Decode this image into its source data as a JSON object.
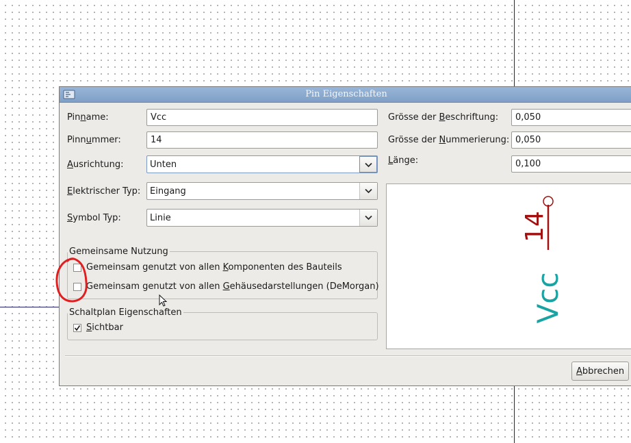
{
  "dialog": {
    "title": "Pin Eigenschaften",
    "pin_name": {
      "label_pre": "Pin",
      "label_acc": "n",
      "label_post": "ame:",
      "value": "Vcc"
    },
    "pin_number": {
      "label_pre": "Pinn",
      "label_acc": "u",
      "label_post": "mmer:",
      "value": "14"
    },
    "orientation": {
      "label_acc": "A",
      "label_post": "usrichtung:",
      "value": "Unten"
    },
    "electrical_type": {
      "label_acc": "E",
      "label_post": "lektrischer Typ:",
      "value": "Eingang"
    },
    "symbol_type": {
      "label_acc": "S",
      "label_post": "ymbol Typ:",
      "value": "Linie"
    },
    "name_size": {
      "label_pre": "Grösse der ",
      "label_acc": "B",
      "label_post": "eschriftung:",
      "value": "0,050"
    },
    "number_size": {
      "label_pre": "Grösse der ",
      "label_acc": "N",
      "label_post": "ummerierung:",
      "value": "0,050"
    },
    "length": {
      "label_acc": "L",
      "label_post": "änge:",
      "value": "0,100"
    },
    "sharing": {
      "legend": "Gemeinsame Nutzung",
      "opt1": {
        "pre": "Gemeinsam genutzt von allen ",
        "acc": "K",
        "post": "omponenten des Bauteils",
        "checked": false
      },
      "opt2": {
        "pre": "Gemeinsam genutzt von allen ",
        "acc": "G",
        "post": "ehäusedarstellungen (DeMorgan)",
        "checked": false
      }
    },
    "schematic": {
      "legend": "Schaltplan Eigenschaften",
      "visible": {
        "acc": "S",
        "post": "ichtbar",
        "checked": true
      }
    },
    "preview": {
      "pin_number": "14",
      "pin_name": "Vcc",
      "number_color": "#a01010",
      "name_color": "#1aa3a3"
    },
    "cancel": {
      "acc": "A",
      "post": "bbrechen"
    }
  },
  "colors": {
    "titlebar": "#8aaad0",
    "annotation": "#e02020"
  }
}
